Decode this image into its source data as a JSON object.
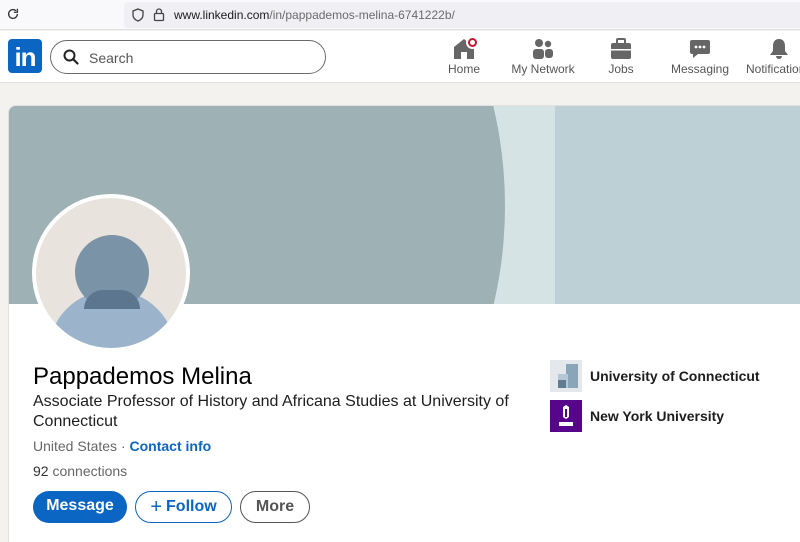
{
  "browser": {
    "url_domain": "www.linkedin.com",
    "url_path": "/in/pappademos-melina-6741222b/"
  },
  "nav": {
    "logo": "in",
    "search_placeholder": "Search",
    "items": [
      {
        "label": "Home",
        "icon": "home-icon"
      },
      {
        "label": "My Network",
        "icon": "network-icon"
      },
      {
        "label": "Jobs",
        "icon": "briefcase-icon"
      },
      {
        "label": "Messaging",
        "icon": "messaging-icon"
      },
      {
        "label": "Notifications",
        "icon": "bell-icon"
      }
    ]
  },
  "profile": {
    "name": "Pappademos Melina",
    "headline": "Associate Professor of History and Africana Studies at University of Connecticut",
    "location": "United States",
    "separator": " · ",
    "contact_info": "Contact info",
    "connections_count": "92",
    "connections_label": " connections"
  },
  "actions": {
    "message": "Message",
    "follow": "Follow",
    "more": "More"
  },
  "education": [
    {
      "name": "University of Connecticut",
      "logo": "uconn-logo"
    },
    {
      "name": "New York University",
      "logo": "nyu-logo"
    }
  ],
  "colors": {
    "brand": "#0a66c2",
    "badge": "#cb112d",
    "nyu_purple": "#57068c"
  }
}
